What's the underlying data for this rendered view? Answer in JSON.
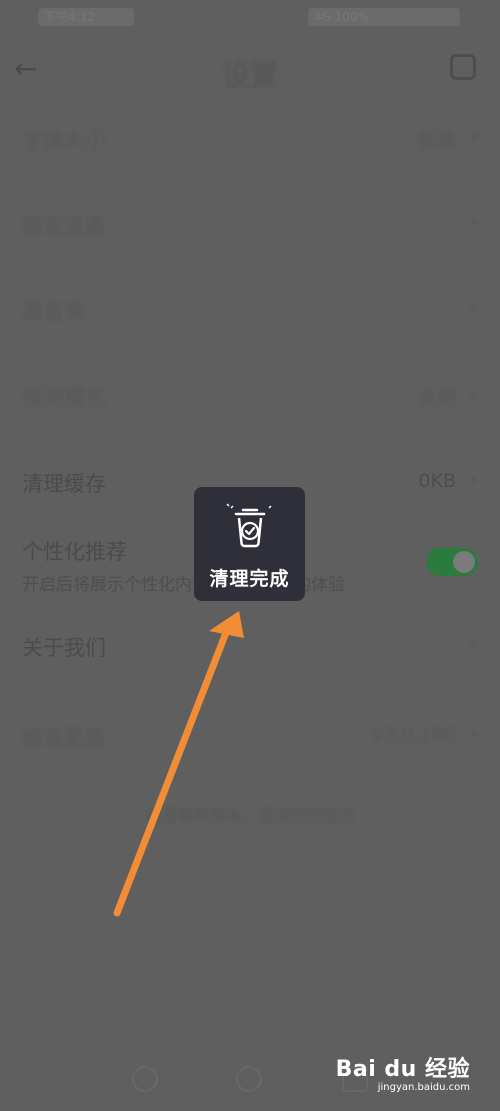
{
  "status_bar": {
    "left_text": "下午4:12",
    "right_text": "4G 100%"
  },
  "header": {
    "title": "设置",
    "back_icon": "back-arrow-icon",
    "action_icon": "scan-icon"
  },
  "settings": [
    {
      "label": "字体大小",
      "value": "标准",
      "icon": "chevron-right-icon"
    },
    {
      "label": "绑定设备",
      "value": "",
      "icon": "chevron-right-icon"
    },
    {
      "label": "黑名单",
      "value": "",
      "icon": "chevron-right-icon"
    },
    {
      "label": "夜间模式",
      "value": "关闭",
      "icon": "chevron-right-icon"
    },
    {
      "label": "清理缓存",
      "value": "0KB",
      "icon": "chevron-right-icon"
    },
    {
      "label": "个性化推荐",
      "sub": "开启后将展示个性化内容，带来更好的体验",
      "toggle_on": true
    },
    {
      "label": "关于我们",
      "value": "",
      "icon": "chevron-right-icon"
    },
    {
      "label": "检查更新",
      "value": "V3.0.100",
      "icon": "chevron-right-icon"
    }
  ],
  "footer_note": "已是最新版本，感谢您的使用",
  "toast": {
    "text": "清理完成",
    "icon": "trash-check-icon"
  },
  "annotation": {
    "icon": "orange-arrow-icon",
    "color": "#f28d36"
  },
  "watermark": {
    "logo": "Bai du 经验",
    "url": "jingyan.baidu.com"
  },
  "colors": {
    "overlay": "#5f5f5f",
    "toast_bg": "#2e2f39",
    "toggle_on": "#2a7b3d"
  }
}
